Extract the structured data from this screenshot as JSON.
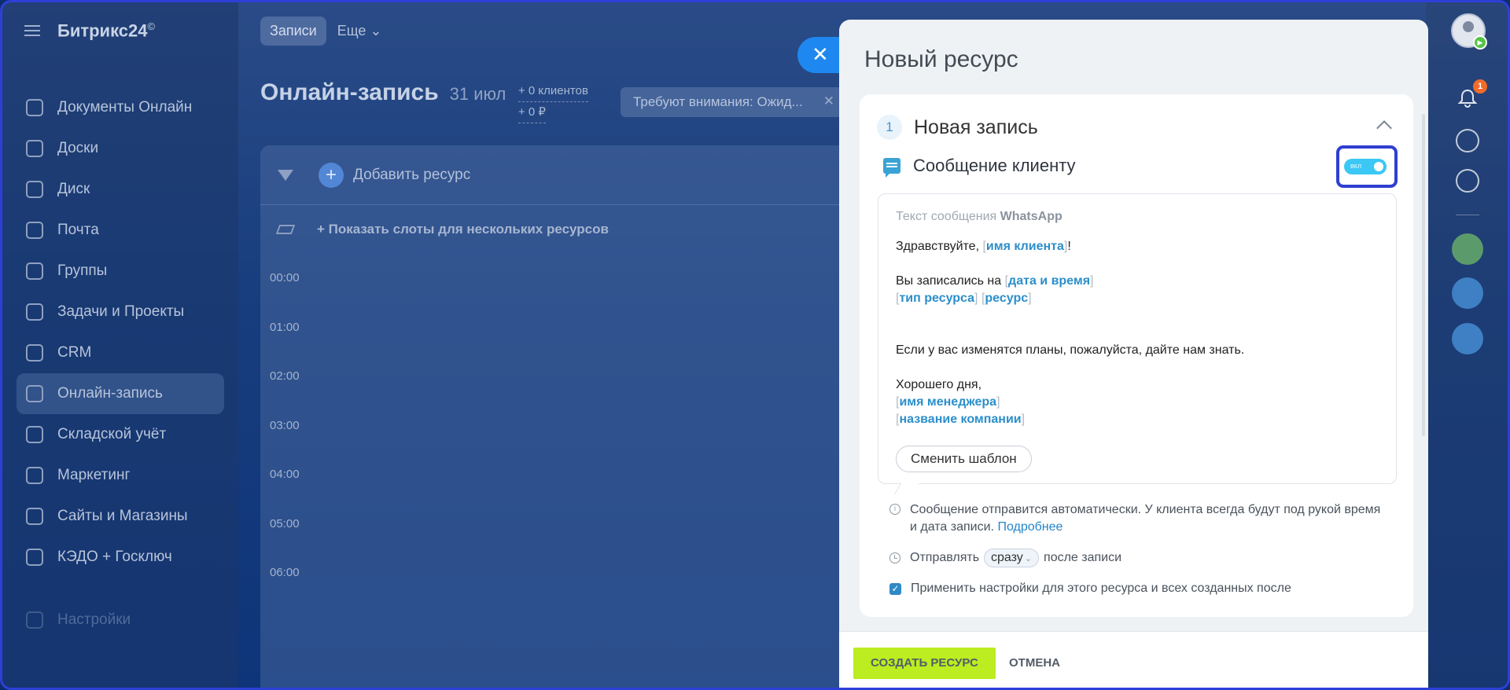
{
  "app": {
    "logo": "Битрикс24",
    "logo_mark": "©"
  },
  "sidebar": {
    "items": [
      {
        "label": "Документы Онлайн"
      },
      {
        "label": "Доски"
      },
      {
        "label": "Диск"
      },
      {
        "label": "Почта"
      },
      {
        "label": "Группы"
      },
      {
        "label": "Задачи и Проекты"
      },
      {
        "label": "CRM"
      },
      {
        "label": "Онлайн-запись"
      },
      {
        "label": "Складской учёт"
      },
      {
        "label": "Маркетинг"
      },
      {
        "label": "Сайты и Магазины"
      },
      {
        "label": "КЭДО + Госключ"
      },
      {
        "label": "Настройки"
      }
    ]
  },
  "topbar": {
    "tab_active": "Записи",
    "tab_more": "Еще"
  },
  "page": {
    "title": "Онлайн-запись",
    "date": "31 июл",
    "clients": "+ 0 клиентов",
    "revenue": "+ 0 ₽",
    "attention": "Требуют внимания: Ожид..."
  },
  "calendar": {
    "add_resource": "Добавить ресурс",
    "show_slots": "Показать слоты для нескольких ресурсов",
    "times": [
      "00:00",
      "01:00",
      "02:00",
      "03:00",
      "04:00",
      "05:00",
      "06:00"
    ]
  },
  "slider": {
    "title": "Новый ресурс",
    "step_number": "1",
    "step_title": "Новая запись",
    "message_title": "Сообщение клиенту",
    "toggle_label": "вкл",
    "toggle_on": true,
    "msg_label": "Текст сообщения",
    "msg_channel": "WhatsApp",
    "greeting": "Здравствуйте, ",
    "ph_client": "имя клиента",
    "booked_prefix": "Вы записались на ",
    "ph_datetime": "дата и время",
    "ph_resource_type": "тип ресурса",
    "ph_resource": "ресурс",
    "plans_text": "Если у вас изменятся планы, пожалуйста, дайте нам знать.",
    "good_day": "Хорошего дня,",
    "ph_manager": "имя менеджера",
    "ph_company": "название компании",
    "change_template": "Сменить шаблон",
    "info_text": "Сообщение отправится автоматически. У клиента всегда будут под рукой время и дата записи.",
    "info_link": "Подробнее",
    "send_prefix": "Отправлять",
    "send_option": "сразу",
    "send_suffix": "после записи",
    "apply_checked": true,
    "apply_text": "Применить настройки для этого ресурса и всех созданных после",
    "create_button": "СОЗДАТЬ РЕСУРС",
    "cancel_button": "ОТМЕНА"
  },
  "notifications": {
    "count": "1"
  },
  "icons": {
    "close": "close-icon",
    "bell": "bell-icon",
    "chevron_up": "chevron-up-icon",
    "message": "message-icon",
    "info": "info-icon",
    "clock": "clock-icon"
  },
  "colors": {
    "accent_blue": "#2b8fcb",
    "toggle": "#3bc8f5",
    "create_button": "#bbed21",
    "highlight_frame": "#2f3fd0",
    "close_button": "#1e88f0"
  }
}
